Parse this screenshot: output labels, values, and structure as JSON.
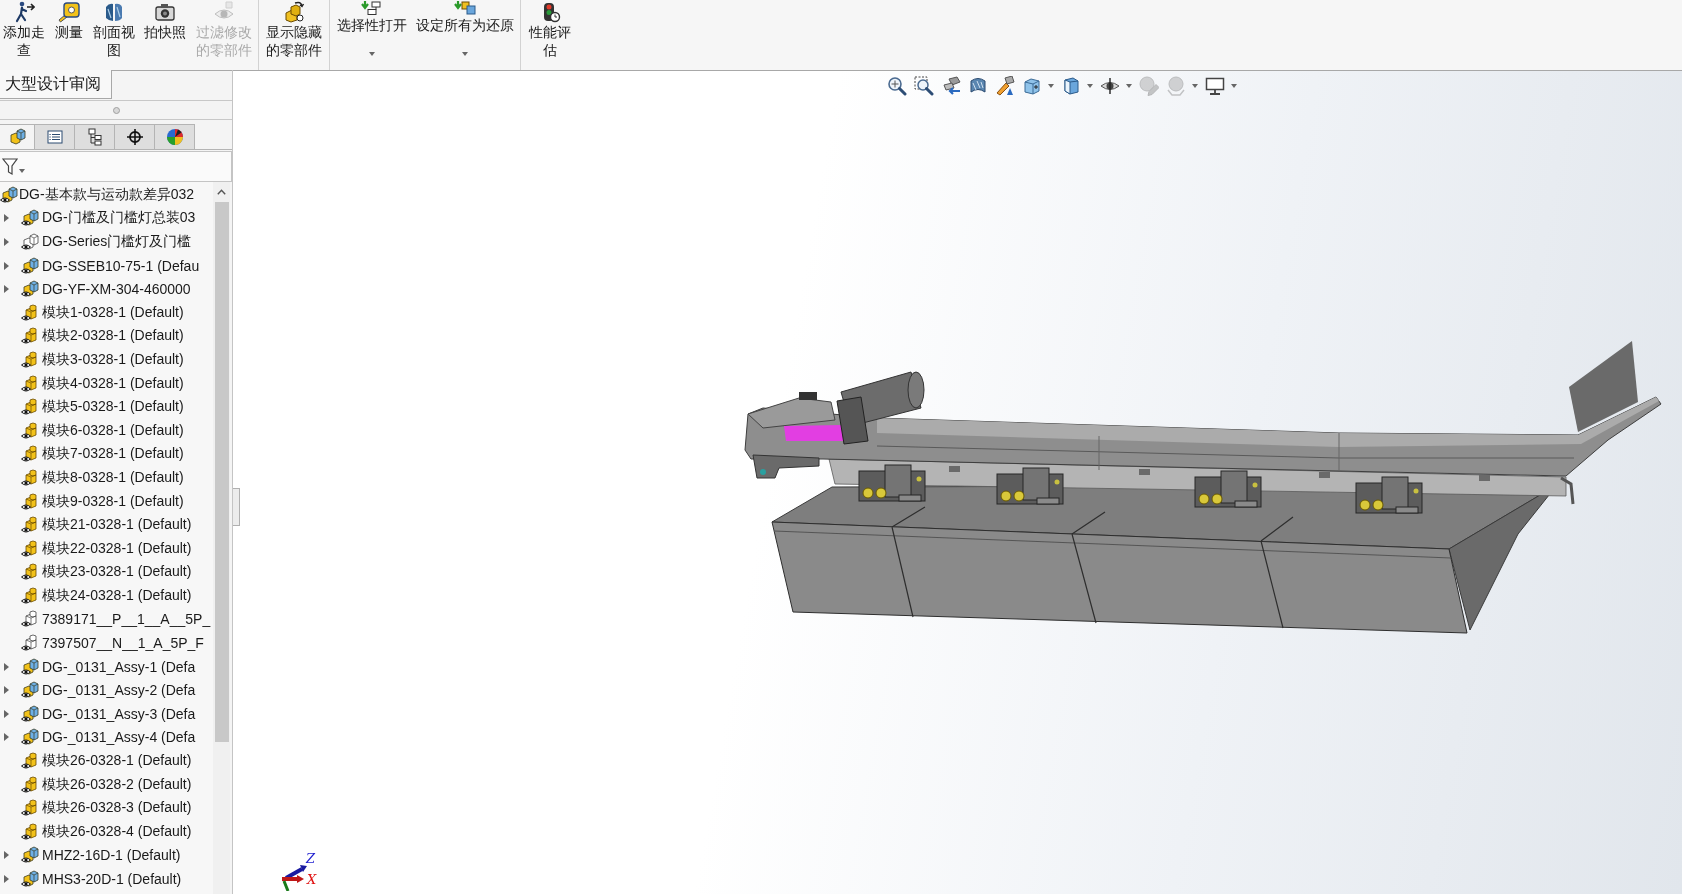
{
  "toolbar": {
    "groups": [
      {
        "buttons": [
          {
            "label": "添加走查",
            "disabled": false
          },
          {
            "label": "测量",
            "disabled": false
          },
          {
            "label": "剖面视图",
            "disabled": false
          },
          {
            "label": "拍快照",
            "disabled": false
          },
          {
            "label": "过滤修改的零部件",
            "disabled": true
          }
        ]
      },
      {
        "buttons": [
          {
            "label": "显示隐藏的零部件",
            "disabled": false
          }
        ]
      },
      {
        "buttons": [
          {
            "label": "选择性打开",
            "disabled": false,
            "dropdown": true
          },
          {
            "label": "设定所有为还原",
            "disabled": false,
            "dropdown": true
          }
        ]
      },
      {
        "buttons": [
          {
            "label": "性能评估",
            "disabled": false
          }
        ]
      }
    ]
  },
  "panel_tabs": [
    {
      "label": "大型设计审阅",
      "selected": true
    }
  ],
  "manager_tabs": [
    {
      "selected": true
    },
    {
      "selected": false
    },
    {
      "selected": false
    },
    {
      "selected": false
    },
    {
      "selected": false
    }
  ],
  "tree": {
    "label": "DG-基本款与运动款差异032",
    "kind": "assembly",
    "children": [
      {
        "label": "DG-门槛及门槛灯总装03",
        "kind": "assembly",
        "expanded": false
      },
      {
        "label": "DG-Series门槛灯及门槛",
        "kind": "assembly-outline",
        "expanded": false
      },
      {
        "label": "DG-SSEB10-75-1 (Defau",
        "kind": "assembly",
        "expanded": false
      },
      {
        "label": "DG-YF-XM-304-460000",
        "kind": "assembly",
        "expanded": false
      },
      {
        "label": "模块1-0328-1 (Default)",
        "kind": "part"
      },
      {
        "label": "模块2-0328-1 (Default)",
        "kind": "part"
      },
      {
        "label": "模块3-0328-1 (Default)",
        "kind": "part"
      },
      {
        "label": "模块4-0328-1 (Default)",
        "kind": "part"
      },
      {
        "label": "模块5-0328-1 (Default)",
        "kind": "part"
      },
      {
        "label": "模块6-0328-1 (Default)",
        "kind": "part"
      },
      {
        "label": "模块7-0328-1 (Default)",
        "kind": "part"
      },
      {
        "label": "模块8-0328-1 (Default)",
        "kind": "part"
      },
      {
        "label": "模块9-0328-1 (Default)",
        "kind": "part"
      },
      {
        "label": "模块21-0328-1 (Default)",
        "kind": "part"
      },
      {
        "label": "模块22-0328-1 (Default)",
        "kind": "part"
      },
      {
        "label": "模块23-0328-1 (Default)",
        "kind": "part"
      },
      {
        "label": "模块24-0328-1 (Default)",
        "kind": "part"
      },
      {
        "label": "7389171__P__1__A__5P_",
        "kind": "part-outline"
      },
      {
        "label": "7397507__N__1_A_5P_F",
        "kind": "part-outline"
      },
      {
        "label": "DG-_0131_Assy-1 (Defa",
        "kind": "assembly",
        "expanded": false
      },
      {
        "label": "DG-_0131_Assy-2 (Defa",
        "kind": "assembly",
        "expanded": false
      },
      {
        "label": "DG-_0131_Assy-3 (Defa",
        "kind": "assembly",
        "expanded": false
      },
      {
        "label": "DG-_0131_Assy-4 (Defa",
        "kind": "assembly",
        "expanded": false
      },
      {
        "label": "模块26-0328-1 (Default)",
        "kind": "part"
      },
      {
        "label": "模块26-0328-2 (Default)",
        "kind": "part"
      },
      {
        "label": "模块26-0328-3 (Default)",
        "kind": "part"
      },
      {
        "label": "模块26-0328-4 (Default)",
        "kind": "part"
      },
      {
        "label": "MHZ2-16D-1 (Default)",
        "kind": "assembly",
        "expanded": false
      },
      {
        "label": "MHS3-20D-1 (Default)",
        "kind": "assembly",
        "expanded": false
      }
    ]
  },
  "view_tools": [
    {
      "disabled": false
    },
    {
      "disabled": false
    },
    {
      "disabled": false
    },
    {
      "disabled": false
    },
    {
      "disabled": false
    },
    {
      "disabled": false,
      "dropdown": true
    },
    {
      "disabled": false,
      "dropdown": true
    },
    {
      "disabled": false,
      "dropdown": true
    },
    {
      "disabled": true
    },
    {
      "disabled": true,
      "dropdown": true
    },
    {
      "disabled": false,
      "dropdown": true
    }
  ],
  "triad": {
    "labels": [
      "Z",
      "X"
    ]
  }
}
